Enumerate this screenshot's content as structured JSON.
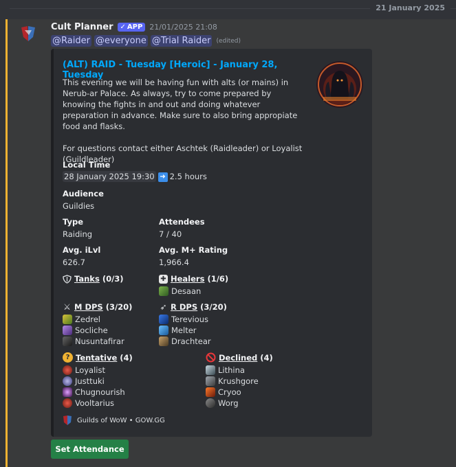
{
  "date_divider": "21 January 2025",
  "message": {
    "author": "Cult Planner",
    "badge": "APP",
    "timestamp": "21/01/2025 21:08",
    "mentions": [
      "@Raider",
      "@everyone",
      "@Trial Raider"
    ],
    "edited": "(edited)"
  },
  "embed": {
    "title": "(ALT) RAID - Tuesday [Heroic] - January 28, Tuesday",
    "description": "This evening we will be having fun with alts (or mains) in Nerub-ar Palace. As always, try to come prepared by knowing the fights in and out and doing whatever preparation in advance. Make sure to also bring appropiate food and flasks.\n\nFor questions contact either Aschtek (Raidleader) or Loyalist (Guildleader)",
    "local_time_label": "Local Time",
    "local_time_value": "28 January 2025 19:30",
    "duration": "2.5 hours",
    "audience_label": "Audience",
    "audience_value": "Guildies",
    "type_label": "Type",
    "type_value": "Raiding",
    "attendees_label": "Attendees",
    "attendees_value": "7 / 40",
    "ilvl_label": "Avg. iLvl",
    "ilvl_value": "626.7",
    "mplus_label": "Avg. M+ Rating",
    "mplus_value": "1,966.4",
    "tanks": {
      "label": "Tanks",
      "count": " (0/3)",
      "players": []
    },
    "healers": {
      "label": "Healers",
      "count": " (1/6)",
      "players": [
        "Desaan"
      ]
    },
    "mdps": {
      "label": "M DPS",
      "count": " (3/20)",
      "players": [
        "Zedrel",
        "Socliche",
        "Nusuntafirar"
      ]
    },
    "rdps": {
      "label": "R DPS",
      "count": " (3/20)",
      "players": [
        "Terevious",
        "Melter",
        "Drachtear"
      ]
    },
    "tentative": {
      "label": "Tentative",
      "count": " (4)",
      "players": [
        "Loyalist",
        "Justtuki",
        "Chugnourish",
        "Vooltarius"
      ]
    },
    "declined": {
      "label": "Declined",
      "count": " (4)",
      "players": [
        "Lithina",
        "Krushgore",
        "Cryoo",
        "Worg"
      ]
    },
    "footer": "Guilds of WoW • GOW.GG"
  },
  "button_label": "Set Attendance"
}
